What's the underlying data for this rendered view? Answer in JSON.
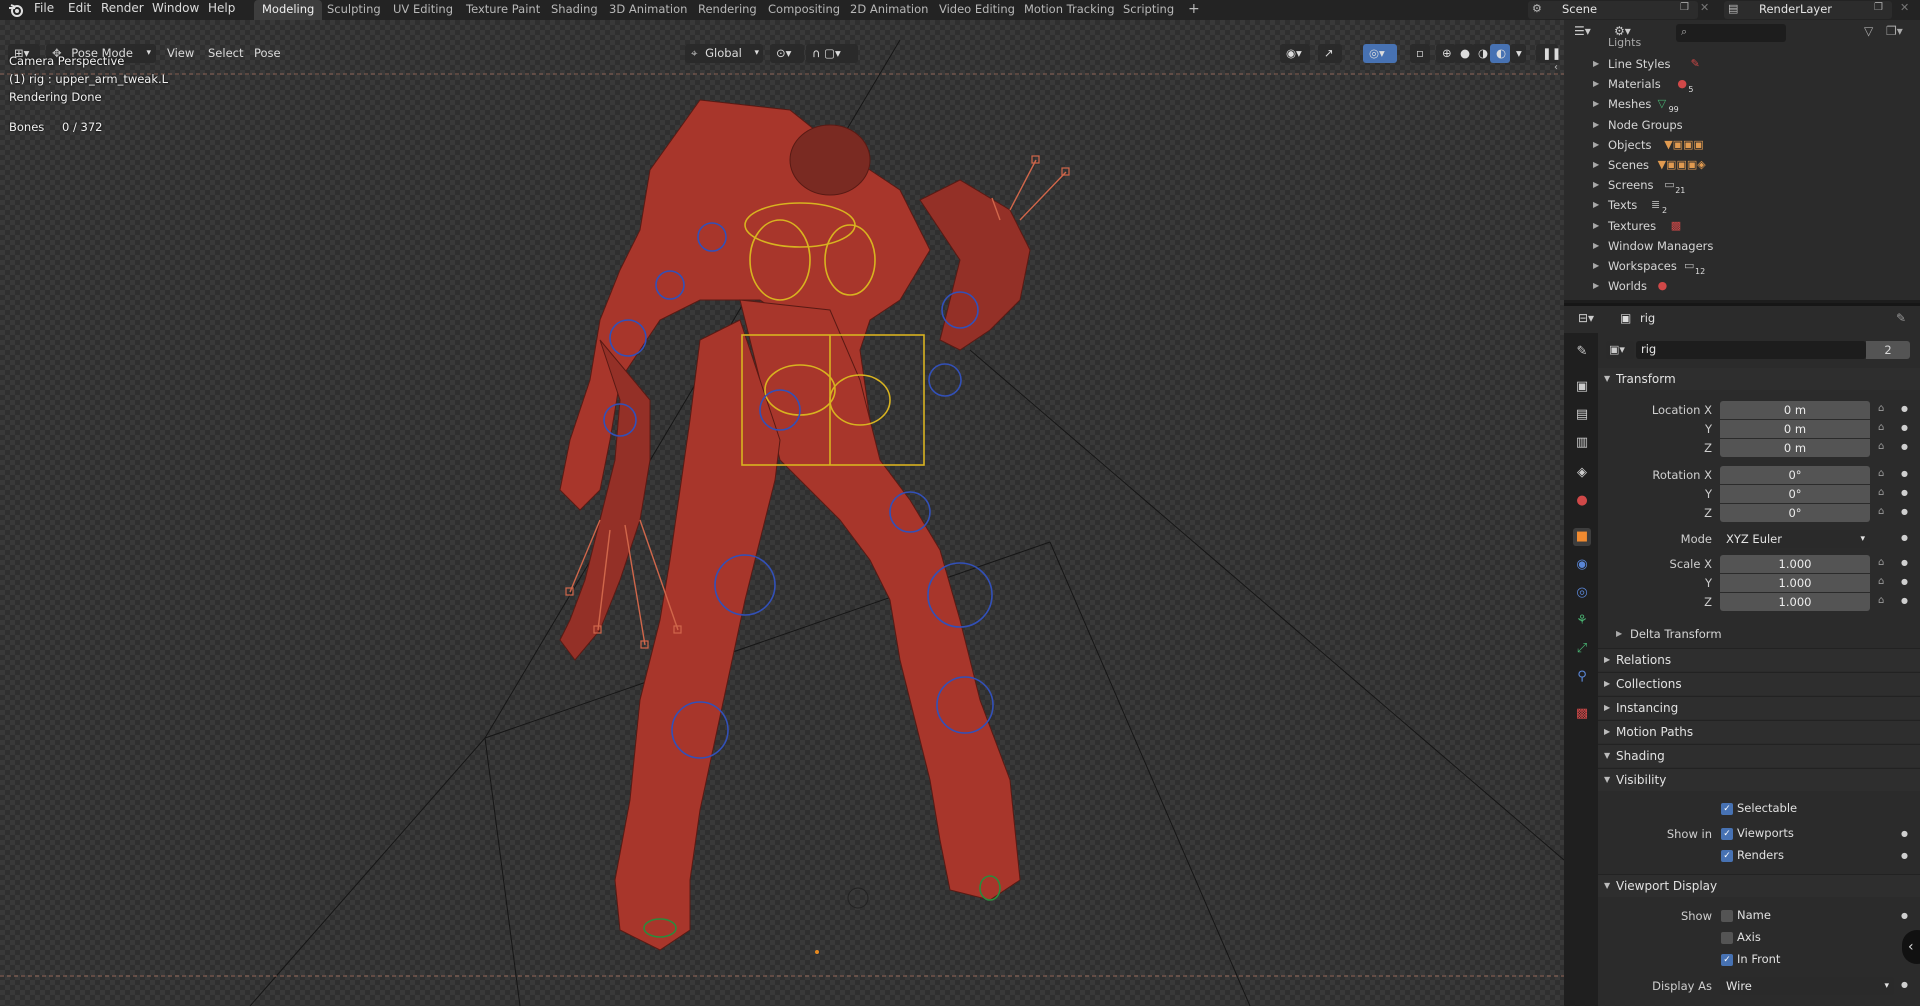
{
  "menu": [
    "File",
    "Edit",
    "Render",
    "Window",
    "Help"
  ],
  "workspaces": [
    "Modeling",
    "Sculpting",
    "UV Editing",
    "Texture Paint",
    "Shading",
    "3D Animation",
    "Rendering",
    "Compositing",
    "2D Animation",
    "Video Editing",
    "Motion Tracking",
    "Scripting"
  ],
  "active_workspace": "Modeling",
  "scene": {
    "label": "Scene",
    "layer": "RenderLayer"
  },
  "viewport": {
    "mode": "Pose Mode",
    "menus": [
      "View",
      "Select",
      "Pose"
    ],
    "orientation": "Global",
    "overlay_title": "Camera Perspective",
    "overlay_object": "(1) rig : upper_arm_tweak.L",
    "overlay_status": "Rendering Done",
    "bones_label": "Bones",
    "bones_value": "0 / 372"
  },
  "outliner": {
    "partial_top": "Lights",
    "items": [
      {
        "label": "Line Styles",
        "icon": "linestyle-icon",
        "badge": ""
      },
      {
        "label": "Materials",
        "icon": "material-icon",
        "badge": "5"
      },
      {
        "label": "Meshes",
        "icon": "mesh-icon",
        "badge": "99"
      },
      {
        "label": "Node Groups",
        "icon": "",
        "badge": ""
      },
      {
        "label": "Objects",
        "icon": "object-icon",
        "badge": ""
      },
      {
        "label": "Scenes",
        "icon": "scene-icon",
        "badge": ""
      },
      {
        "label": "Screens",
        "icon": "screen-icon",
        "badge": "21"
      },
      {
        "label": "Texts",
        "icon": "text-icon",
        "badge": "2"
      },
      {
        "label": "Textures",
        "icon": "texture-icon",
        "badge": ""
      },
      {
        "label": "Window Managers",
        "icon": "",
        "badge": ""
      },
      {
        "label": "Workspaces",
        "icon": "workspace-icon",
        "badge": "12"
      },
      {
        "label": "Worlds",
        "icon": "world-icon",
        "badge": ""
      }
    ]
  },
  "properties": {
    "header_object": "rig",
    "name_field": "rig",
    "users": "2",
    "transform": {
      "title": "Transform",
      "location_label": "Location X",
      "loc_x": "0 m",
      "loc_y": "0 m",
      "loc_z": "0 m",
      "rotation_label": "Rotation X",
      "rot_x": "0°",
      "rot_y": "0°",
      "rot_z": "0°",
      "mode_label": "Mode",
      "mode": "XYZ Euler",
      "scale_label": "Scale X",
      "scale_x": "1.000",
      "scale_y": "1.000",
      "scale_z": "1.000",
      "y": "Y",
      "z": "Z",
      "delta": "Delta Transform"
    },
    "collapsed_panels": [
      "Relations",
      "Collections",
      "Instancing",
      "Motion Paths",
      "Shading"
    ],
    "visibility": {
      "title": "Visibility",
      "selectable": "Selectable",
      "show_in": "Show in",
      "viewports": "Viewports",
      "renders": "Renders"
    },
    "viewport_display": {
      "title": "Viewport Display",
      "show": "Show",
      "name": "Name",
      "axis": "Axis",
      "in_front": "In Front",
      "display_as_label": "Display As",
      "display_as": "Wire"
    }
  },
  "colors": {
    "accent": "#4772b3",
    "active_tab": "#3d3d3d",
    "robot": "#b33a2c",
    "bone_yellow": "#d8b320",
    "bone_blue": "#3250b8"
  }
}
